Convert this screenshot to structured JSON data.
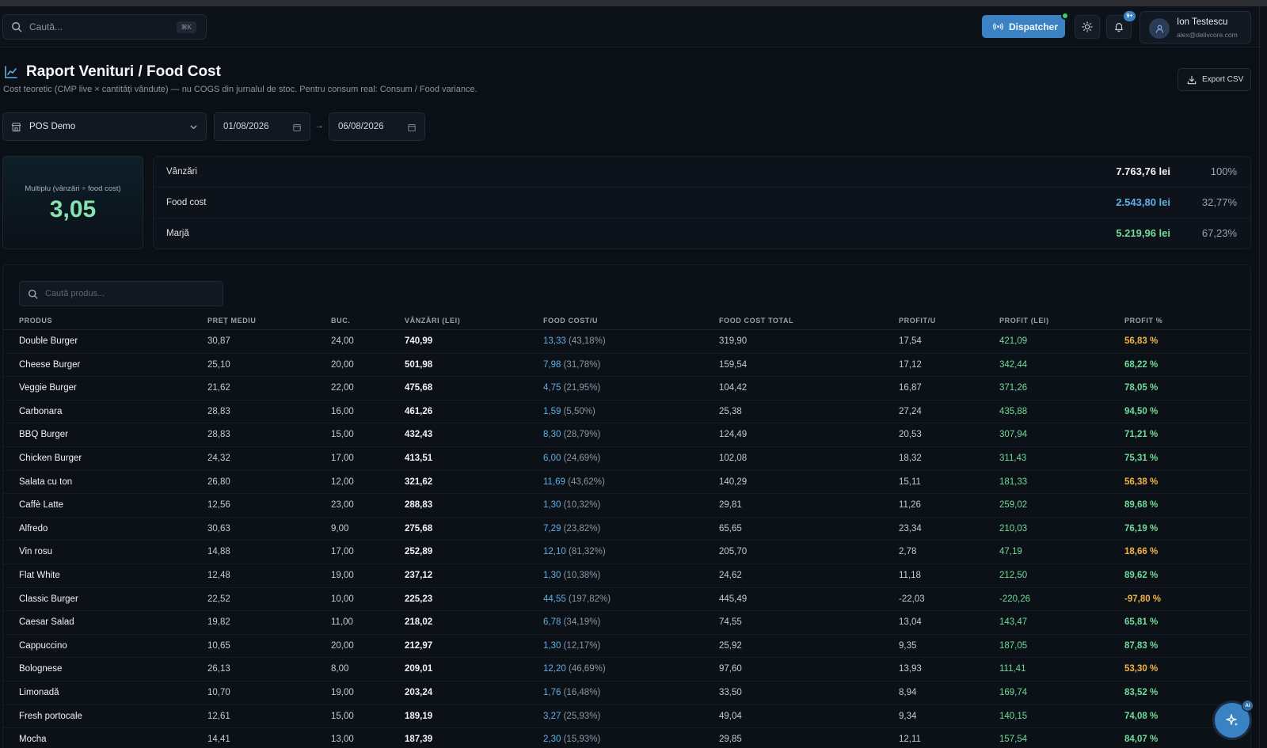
{
  "header": {
    "search_placeholder": "Caută...",
    "search_shortcut": "⌘K",
    "dispatcher_label": "Dispatcher",
    "notifications_badge": "9+",
    "user_name": "Ion Testescu",
    "user_email": "alex@delivcore.com"
  },
  "page": {
    "title": "Raport Venituri / Food Cost",
    "subtitle": "Cost teoretic (CMP live × cantități vândute) — nu COGS din jurnalul de stoc. Pentru consum real: Consum / Food variance.",
    "export_label": "Export CSV"
  },
  "filters": {
    "location": "POS Demo",
    "date_from": "01/08/2026",
    "date_to": "06/08/2026",
    "arrow": "→"
  },
  "summary": {
    "multiple_label": "Multiplu (vânzări ÷ food cost)",
    "multiple_value": "3,05",
    "rows": [
      {
        "label": "Vânzări",
        "amount": "7.763,76 lei",
        "pct": "100%",
        "color": "#f0f2f5"
      },
      {
        "label": "Food cost",
        "amount": "2.543,80 lei",
        "pct": "32,77%",
        "color": "#5fb0e6"
      },
      {
        "label": "Marjă",
        "amount": "5.219,96 lei",
        "pct": "67,23%",
        "color": "#6fdc98"
      }
    ]
  },
  "table": {
    "search_placeholder": "Caută produs...",
    "headers": [
      "PRODUS",
      "PREȚ MEDIU",
      "BUC.",
      "VÂNZĂRI (LEI)",
      "FOOD COST/U",
      "FOOD COST TOTAL",
      "PROFIT/U",
      "PROFIT (LEI)",
      "PROFIT %"
    ],
    "rows": [
      {
        "name": "Double Burger",
        "price": "30,87",
        "qty": "24,00",
        "sales": "740,99",
        "fc_u": "13,33",
        "fc_pct": "(43,18%)",
        "fc_total": "319,90",
        "profit_u": "17,54",
        "profit": "421,09",
        "profit_pct": "56,83 %",
        "tone": "yellow"
      },
      {
        "name": "Cheese Burger",
        "price": "25,10",
        "qty": "20,00",
        "sales": "501,98",
        "fc_u": "7,98",
        "fc_pct": "(31,78%)",
        "fc_total": "159,54",
        "profit_u": "17,12",
        "profit": "342,44",
        "profit_pct": "68,22 %",
        "tone": "green"
      },
      {
        "name": "Veggie Burger",
        "price": "21,62",
        "qty": "22,00",
        "sales": "475,68",
        "fc_u": "4,75",
        "fc_pct": "(21,95%)",
        "fc_total": "104,42",
        "profit_u": "16,87",
        "profit": "371,26",
        "profit_pct": "78,05 %",
        "tone": "green"
      },
      {
        "name": "Carbonara",
        "price": "28,83",
        "qty": "16,00",
        "sales": "461,26",
        "fc_u": "1,59",
        "fc_pct": "(5,50%)",
        "fc_total": "25,38",
        "profit_u": "27,24",
        "profit": "435,88",
        "profit_pct": "94,50 %",
        "tone": "green"
      },
      {
        "name": "BBQ Burger",
        "price": "28,83",
        "qty": "15,00",
        "sales": "432,43",
        "fc_u": "8,30",
        "fc_pct": "(28,79%)",
        "fc_total": "124,49",
        "profit_u": "20,53",
        "profit": "307,94",
        "profit_pct": "71,21 %",
        "tone": "green"
      },
      {
        "name": "Chicken Burger",
        "price": "24,32",
        "qty": "17,00",
        "sales": "413,51",
        "fc_u": "6,00",
        "fc_pct": "(24,69%)",
        "fc_total": "102,08",
        "profit_u": "18,32",
        "profit": "311,43",
        "profit_pct": "75,31 %",
        "tone": "green"
      },
      {
        "name": "Salata cu ton",
        "price": "26,80",
        "qty": "12,00",
        "sales": "321,62",
        "fc_u": "11,69",
        "fc_pct": "(43,62%)",
        "fc_total": "140,29",
        "profit_u": "15,11",
        "profit": "181,33",
        "profit_pct": "56,38 %",
        "tone": "yellow"
      },
      {
        "name": "Caffè Latte",
        "price": "12,56",
        "qty": "23,00",
        "sales": "288,83",
        "fc_u": "1,30",
        "fc_pct": "(10,32%)",
        "fc_total": "29,81",
        "profit_u": "11,26",
        "profit": "259,02",
        "profit_pct": "89,68 %",
        "tone": "green"
      },
      {
        "name": "Alfredo",
        "price": "30,63",
        "qty": "9,00",
        "sales": "275,68",
        "fc_u": "7,29",
        "fc_pct": "(23,82%)",
        "fc_total": "65,65",
        "profit_u": "23,34",
        "profit": "210,03",
        "profit_pct": "76,19 %",
        "tone": "green"
      },
      {
        "name": "Vin rosu",
        "price": "14,88",
        "qty": "17,00",
        "sales": "252,89",
        "fc_u": "12,10",
        "fc_pct": "(81,32%)",
        "fc_total": "205,70",
        "profit_u": "2,78",
        "profit": "47,19",
        "profit_pct": "18,66 %",
        "tone": "yellow"
      },
      {
        "name": "Flat White",
        "price": "12,48",
        "qty": "19,00",
        "sales": "237,12",
        "fc_u": "1,30",
        "fc_pct": "(10,38%)",
        "fc_total": "24,62",
        "profit_u": "11,18",
        "profit": "212,50",
        "profit_pct": "89,62 %",
        "tone": "green"
      },
      {
        "name": "Classic Burger",
        "price": "22,52",
        "qty": "10,00",
        "sales": "225,23",
        "fc_u": "44,55",
        "fc_pct": "(197,82%)",
        "fc_total": "445,49",
        "profit_u": "-22,03",
        "profit": "-220,26",
        "profit_pct": "-97,80 %",
        "tone": "yellow"
      },
      {
        "name": "Caesar Salad",
        "price": "19,82",
        "qty": "11,00",
        "sales": "218,02",
        "fc_u": "6,78",
        "fc_pct": "(34,19%)",
        "fc_total": "74,55",
        "profit_u": "13,04",
        "profit": "143,47",
        "profit_pct": "65,81 %",
        "tone": "green"
      },
      {
        "name": "Cappuccino",
        "price": "10,65",
        "qty": "20,00",
        "sales": "212,97",
        "fc_u": "1,30",
        "fc_pct": "(12,17%)",
        "fc_total": "25,92",
        "profit_u": "9,35",
        "profit": "187,05",
        "profit_pct": "87,83 %",
        "tone": "green"
      },
      {
        "name": "Bolognese",
        "price": "26,13",
        "qty": "8,00",
        "sales": "209,01",
        "fc_u": "12,20",
        "fc_pct": "(46,69%)",
        "fc_total": "97,60",
        "profit_u": "13,93",
        "profit": "111,41",
        "profit_pct": "53,30 %",
        "tone": "yellow"
      },
      {
        "name": "Limonadă",
        "price": "10,70",
        "qty": "19,00",
        "sales": "203,24",
        "fc_u": "1,76",
        "fc_pct": "(16,48%)",
        "fc_total": "33,50",
        "profit_u": "8,94",
        "profit": "169,74",
        "profit_pct": "83,52 %",
        "tone": "green"
      },
      {
        "name": "Fresh portocale",
        "price": "12,61",
        "qty": "15,00",
        "sales": "189,19",
        "fc_u": "3,27",
        "fc_pct": "(25,93%)",
        "fc_total": "49,04",
        "profit_u": "9,34",
        "profit": "140,15",
        "profit_pct": "74,08 %",
        "tone": "green"
      },
      {
        "name": "Mocha",
        "price": "14,41",
        "qty": "13,00",
        "sales": "187,39",
        "fc_u": "2,30",
        "fc_pct": "(15,93%)",
        "fc_total": "29,85",
        "profit_u": "12,11",
        "profit": "157,54",
        "profit_pct": "84,07 %",
        "tone": "green"
      }
    ]
  },
  "ai": {
    "badge": "AI",
    "icon": "sparkle-icon"
  },
  "icons": {
    "search": "search-icon",
    "broadcast": "broadcast-icon",
    "theme": "sun-icon",
    "bell": "bell-icon",
    "user": "user-icon",
    "chart": "chart-line-icon",
    "download": "download-icon",
    "store": "store-icon",
    "chevron": "chevron-down-icon",
    "calendar": "calendar-icon"
  },
  "colors": {
    "accent": "#3b82c4",
    "food_cost": "#5fb0e6",
    "profit": "#6fdc98",
    "warning": "#f1b544"
  }
}
